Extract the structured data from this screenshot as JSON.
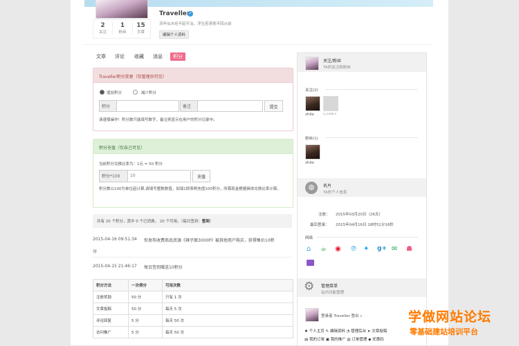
{
  "profile": {
    "name": "Traveller",
    "motto": "流年似水经不起平淡，浮生若茶挑不回从前",
    "edit_button": "编辑个人资料",
    "stats": [
      {
        "num": "2",
        "label": "关注"
      },
      {
        "num": "1",
        "label": "粉丝"
      },
      {
        "num": "15",
        "label": "文章"
      }
    ]
  },
  "tabs": [
    {
      "label": "文章"
    },
    {
      "label": "评论"
    },
    {
      "label": "收藏"
    },
    {
      "label": "消息"
    },
    {
      "label": "积分"
    }
  ],
  "points_change": {
    "title": "Traveller积分变更（仅管理员可见）",
    "radio_add": "增加积分",
    "radio_sub": "减少积分",
    "label_points": "积分",
    "label_note": "备注",
    "submit": "提交",
    "help": "请谨慎操作！积分数只能填写数字，备注将显示在用户的积分记录中。"
  },
  "recharge": {
    "title": "积分充值（仅自己可见）",
    "rate": "当前积分兑换比率为：1元 = 50 积分",
    "label": "积分*100",
    "value": "10",
    "button": "充值",
    "help": "积分数以100为单位起计算,请填写整数数值，如填1即表明充值100积分，所需现金根据具体兑换比率计算。"
  },
  "summary": {
    "text": "共有 20 个积分，其中 0 个已消费， 20 个可用。（每日签到：",
    "sign": "签到",
    "tail": "）"
  },
  "records": [
    {
      "time": "2015-04-16 09:51:34",
      "text": "你发布收费商品资源《辣子面3000P》被其他用户购买，获得售价10积",
      "text2": "分"
    },
    {
      "time": "2015-04-15 21:46:17",
      "text": "每日签到赠送10积分"
    }
  ],
  "rules_table": {
    "headers": [
      "积分方法",
      "一次得分",
      "可用次数"
    ],
    "rows": [
      [
        "注册奖励",
        "50 分",
        "只有 1 次"
      ],
      [
        "文章投稿",
        "50 分",
        "每天 5 次"
      ],
      [
        "评论回复",
        "5 分",
        "每天 50 次"
      ],
      [
        "访问推广",
        "5 分",
        "每天 50 次"
      ]
    ]
  },
  "sidebar": {
    "follow": {
      "title": "关注/粉丝",
      "subtitle": "TA的关注和粉丝"
    },
    "following_label": "关注(2)",
    "following": [
      {
        "name": "zhile"
      },
      {
        "name": "x_x.aaa x"
      }
    ],
    "fans_label": "粉丝(1)",
    "fans": [
      {
        "name": "zhile"
      }
    ],
    "card": {
      "title": "名片",
      "subtitle": "TA的个人信息"
    },
    "registered_label": "注册：",
    "registered_value": "2015年03月20日（26天）",
    "last_login_label": "最后登录：",
    "last_login_value": "2015年04月16日 18时51分16秒",
    "social_label": "网络",
    "admin": {
      "title": "管理菜单",
      "subtitle": "站内功能管理"
    },
    "login_text": "登录者 Traveller 登出 »",
    "menu_row1": [
      "个人主页",
      "编辑资料",
      "管理后台",
      "文章投稿"
    ],
    "menu_row2": [
      "我的订单",
      "我的推广",
      "订单管理",
      "优惠码"
    ]
  },
  "watermark": {
    "line1": "学做网站论坛",
    "line2": "零基础建站培训平台"
  },
  "colors": {
    "accent": "#f06c8c",
    "danger_bg": "#f2dede",
    "success_bg": "#dff0d8",
    "link": "#ff7a00"
  }
}
